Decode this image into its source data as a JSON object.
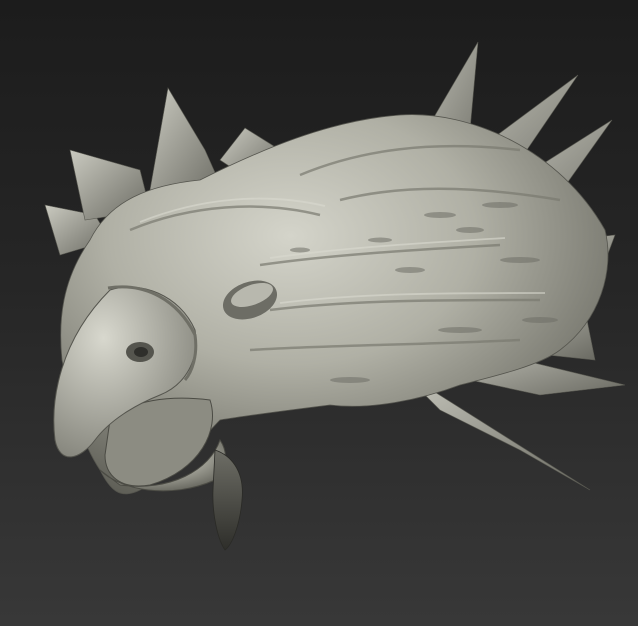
{
  "viewport": {
    "subject": "sculpt-render",
    "background_top": "#1c1c1c",
    "background_bottom": "#383838",
    "sculpt_base_color": "#a7a79c",
    "sculpt_highlight_color": "#d2d2c8",
    "sculpt_shadow_color": "#4b4b44"
  }
}
